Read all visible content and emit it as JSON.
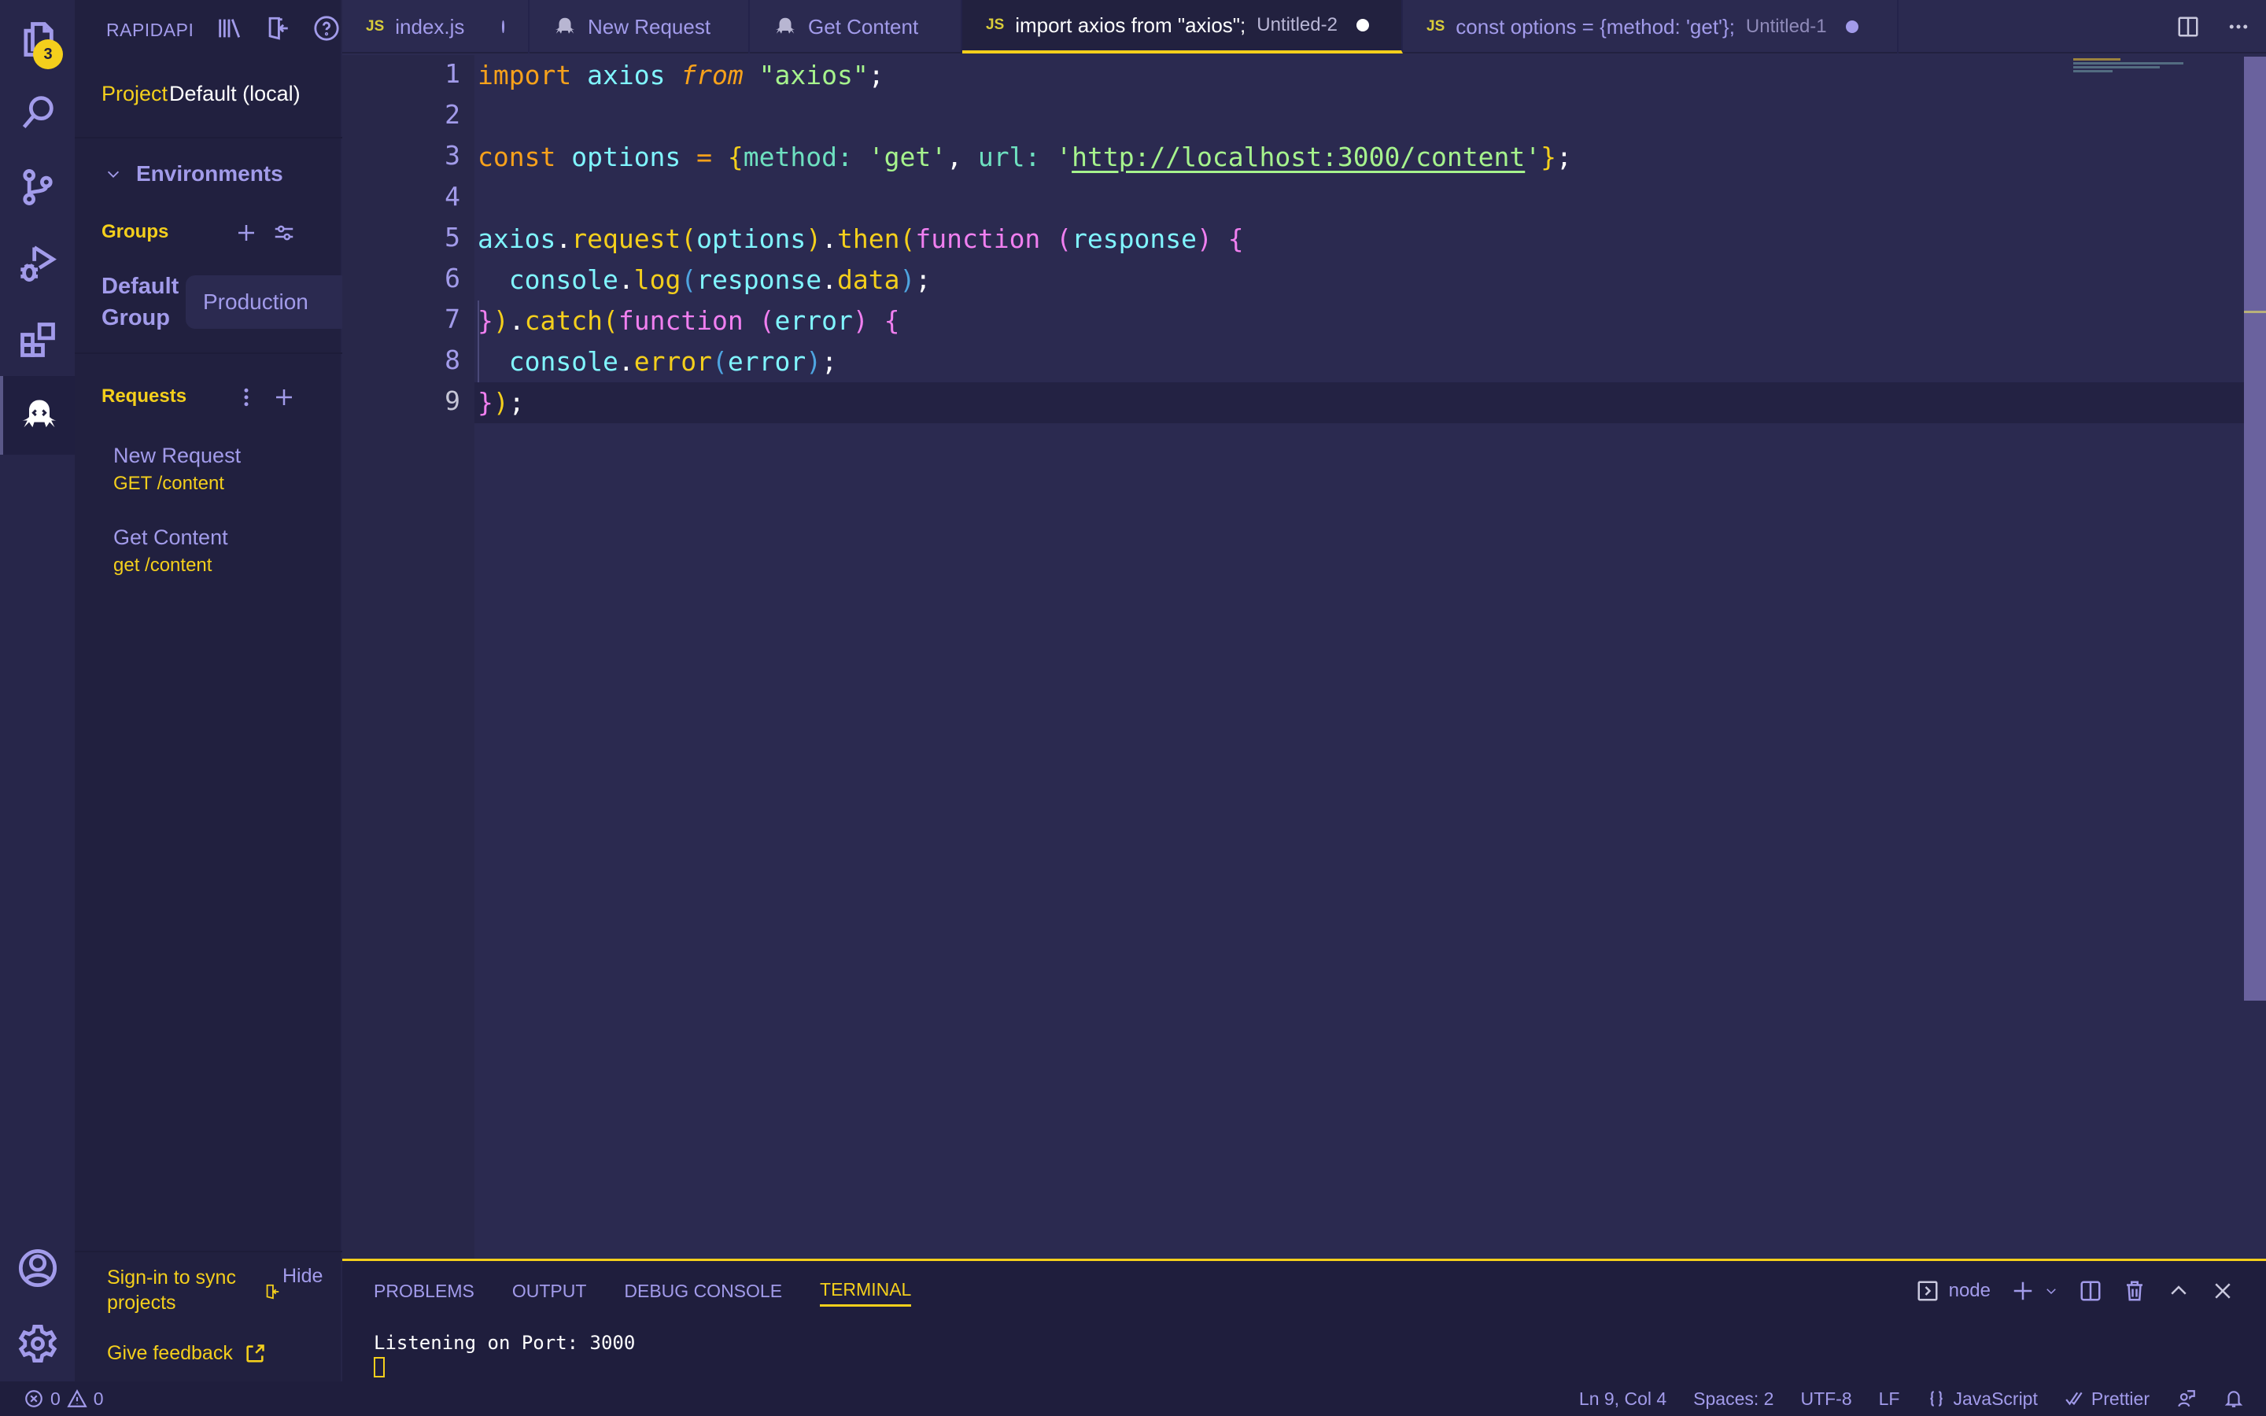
{
  "activity_bar": {
    "items": [
      {
        "name": "explorer",
        "icon": "files-icon",
        "badge": "3"
      },
      {
        "name": "search",
        "icon": "search-icon"
      },
      {
        "name": "source-control",
        "icon": "source-control-icon"
      },
      {
        "name": "run-debug",
        "icon": "run-debug-icon"
      },
      {
        "name": "extensions",
        "icon": "extensions-icon"
      },
      {
        "name": "rapidapi",
        "icon": "rapidapi-octopus-icon",
        "active": true
      }
    ],
    "bottom": [
      {
        "name": "accounts",
        "icon": "account-icon"
      },
      {
        "name": "manage",
        "icon": "gear-icon"
      }
    ]
  },
  "sidebar": {
    "title": "RAPIDAPI",
    "header_icons": [
      "library-icon",
      "sign-in-icon",
      "help-icon"
    ],
    "project_label": "Project",
    "project_value": "Default (local)",
    "environments_label": "Environments",
    "groups_label": "Groups",
    "group_name": "Default Group",
    "environment_selected": "Production",
    "requests_label": "Requests",
    "requests": [
      {
        "name": "New Request",
        "method_path": "GET /content"
      },
      {
        "name": "Get Content",
        "method_path": "get /content"
      }
    ],
    "signin_text": "Sign-in to sync projects",
    "hide_label": "Hide",
    "feedback_label": "Give feedback"
  },
  "tabs": [
    {
      "icon": "JS",
      "label": "index.js",
      "description": "",
      "dirty": true,
      "active": false
    },
    {
      "icon": "rapidapi",
      "label": "New Request",
      "description": "",
      "dirty": false,
      "active": false
    },
    {
      "icon": "rapidapi",
      "label": "Get Content",
      "description": "",
      "dirty": false,
      "active": false
    },
    {
      "icon": "JS",
      "label": "import axios from \"axios\";",
      "description": "Untitled-2",
      "dirty": true,
      "active": true
    },
    {
      "icon": "JS",
      "label": "const options = {method: 'get'};",
      "description": "Untitled-1",
      "dirty": true,
      "active": false
    }
  ],
  "editor": {
    "line_numbers": [
      "1",
      "2",
      "3",
      "4",
      "5",
      "6",
      "7",
      "8",
      "9"
    ],
    "current_line": 9,
    "code": {
      "l1": {
        "kw": "import",
        "var": "axios",
        "from": "from",
        "str": "\"axios\"",
        "end": ";"
      },
      "l3": {
        "kw": "const",
        "var": "options",
        "eq": "=",
        "ob": "{",
        "k1": "method",
        "c1": ":",
        "v1": "'get'",
        "cm": ",",
        "k2": "url",
        "c2": ":",
        "q1": "'",
        "url": "http://localhost:3000/content",
        "q2": "'",
        "cb": "}",
        "end": ";"
      },
      "l5": {
        "obj": "axios",
        "dot1": ".",
        "m1": "request",
        "po": "(",
        "arg": "options",
        "pc": ")",
        "dot2": ".",
        "m2": "then",
        "po2": "(",
        "fk": "function",
        "sp": " ",
        "ao": "(",
        "param": "response",
        "ac": ")",
        "br": "{"
      },
      "l6": {
        "ind": "  ",
        "obj": "console",
        "dot": ".",
        "m": "log",
        "po": "(",
        "a1": "response",
        "dot2": ".",
        "a2": "data",
        "pc": ")",
        "end": ";"
      },
      "l7": {
        "cb": "}",
        "pc": ")",
        "dot": ".",
        "m": "catch",
        "po": "(",
        "fk": "function",
        "sp": " ",
        "ao": "(",
        "param": "error",
        "ac": ")",
        "br": "{"
      },
      "l8": {
        "ind": "  ",
        "obj": "console",
        "dot": ".",
        "m": "error",
        "po": "(",
        "a": "error",
        "pc": ")",
        "end": ";"
      },
      "l9": {
        "cb": "}",
        "pc": ")",
        "end": ";"
      }
    }
  },
  "panel": {
    "tabs": [
      "PROBLEMS",
      "OUTPUT",
      "DEBUG CONSOLE",
      "TERMINAL"
    ],
    "active_tab": "TERMINAL",
    "terminal_name": "node",
    "terminal_output": "Listening on Port: 3000"
  },
  "status_bar": {
    "errors": "0",
    "warnings": "0",
    "position": "Ln 9, Col 4",
    "indent": "Spaces: 2",
    "encoding": "UTF-8",
    "eol": "LF",
    "language": "JavaScript",
    "formatter": "Prettier"
  },
  "colors": {
    "accent": "#f4cf1c",
    "foreground": "#a29bea",
    "editor_bg": "#2b2a50",
    "sidebar_bg": "#21203f"
  }
}
